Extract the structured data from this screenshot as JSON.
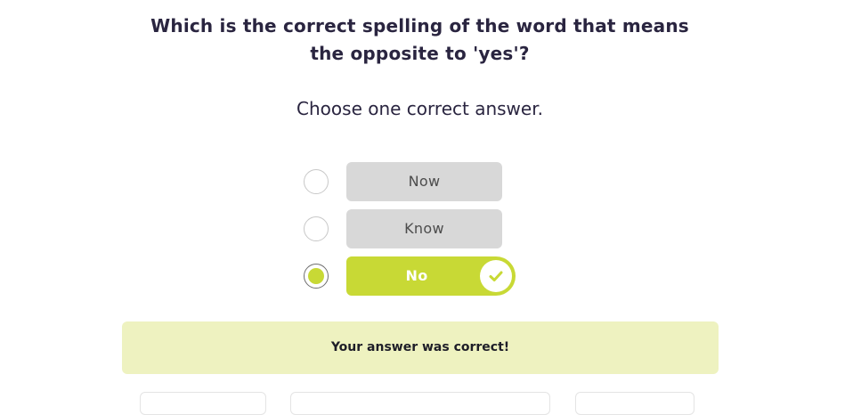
{
  "question": {
    "text": "Which is the correct spelling of the word that means the opposite to 'yes'?",
    "instruction": "Choose one correct answer."
  },
  "options": [
    {
      "label": "Now",
      "selected": false,
      "state": "neutral"
    },
    {
      "label": "Know",
      "selected": false,
      "state": "neutral"
    },
    {
      "label": "No",
      "selected": true,
      "state": "correct"
    }
  ],
  "feedback": {
    "message": "Your answer was correct!"
  },
  "colors": {
    "accent": "#c8d935",
    "option_bg": "#d8d8d8",
    "feedback_bg": "#eef2c0",
    "text": "#2a2540"
  },
  "icons": {
    "correct_indicator": "check-icon"
  }
}
